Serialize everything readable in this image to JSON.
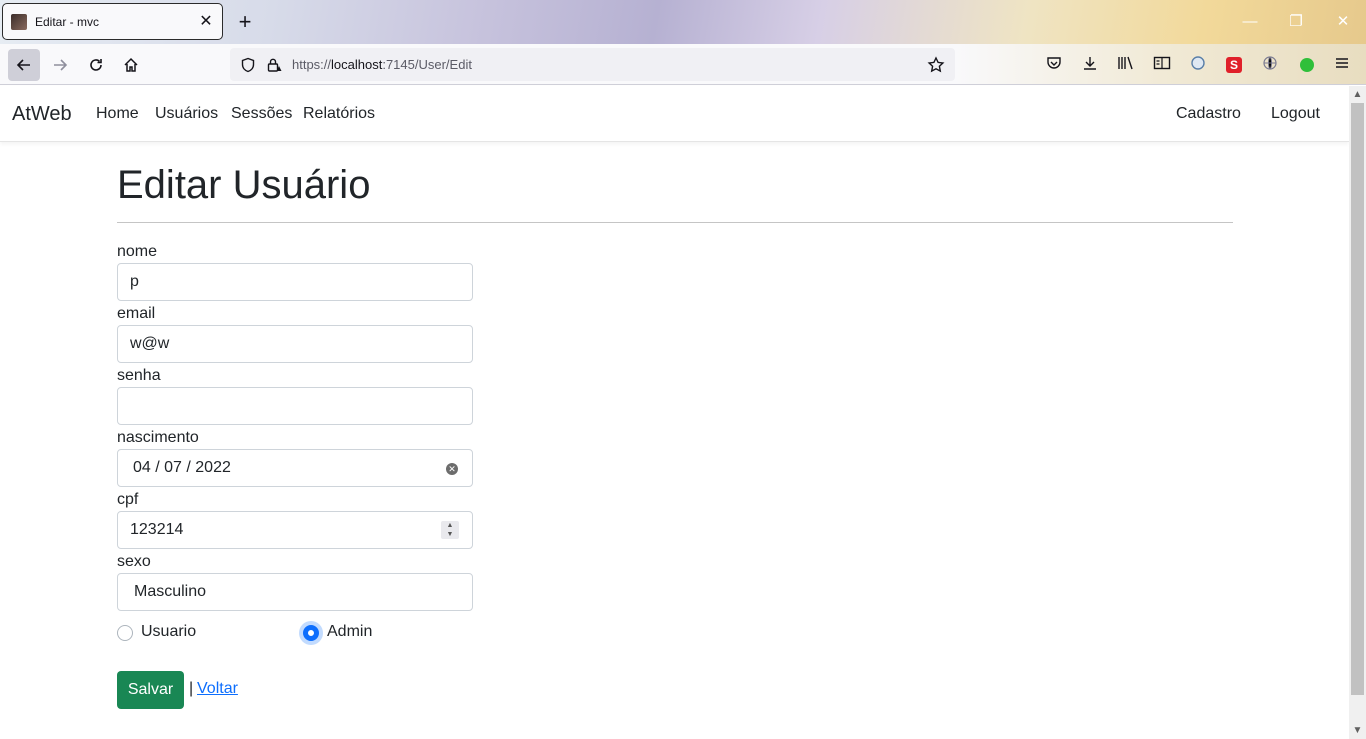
{
  "browser": {
    "tab_title": "Editar - mvc",
    "tab_close": "✕",
    "new_tab": "+",
    "url_prefix": "https://",
    "url_host": "localhost",
    "url_path": ":7145/User/Edit",
    "window_controls": {
      "minimize": "—",
      "maximize": "❐",
      "close": "✕"
    },
    "toolbar_icons": [
      "pocket-icon",
      "download-icon",
      "library-icon",
      "reader-icon",
      "extension-icon",
      "red-extension-icon",
      "globe-icon",
      "green-extension-icon",
      "menu-icon"
    ]
  },
  "app_nav": {
    "brand": "AtWeb",
    "links": [
      "Home",
      "Usuários",
      "Sessões",
      "Relatórios"
    ],
    "right_links": [
      "Cadastro",
      "Logout"
    ]
  },
  "page": {
    "title": "Editar Usuário"
  },
  "form": {
    "nome": {
      "label": "nome",
      "value": "p"
    },
    "email": {
      "label": "email",
      "value": "w@w"
    },
    "senha": {
      "label": "senha",
      "value": ""
    },
    "nascimento": {
      "label": "nascimento",
      "value": "04 / 07 / 2022"
    },
    "cpf": {
      "label": "cpf",
      "value": "123214"
    },
    "sexo": {
      "label": "sexo",
      "value": "Masculino"
    },
    "role_options": [
      {
        "label": "Usuario",
        "checked": false
      },
      {
        "label": "Admin",
        "checked": true
      }
    ],
    "save_label": "Salvar",
    "separator": "|",
    "back_label": "Voltar"
  },
  "colors": {
    "primary": "#0d6efd",
    "success": "#198754"
  }
}
